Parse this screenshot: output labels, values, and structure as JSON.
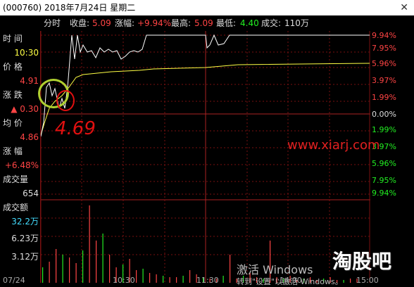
{
  "title_bar": {
    "text": "(000760) 2018年7月24日 星期二",
    "close_glyph": "✕"
  },
  "info": {
    "mode": "分时",
    "close_label": "收盘:",
    "close_value": "5.09",
    "change_label": "涨幅:",
    "change_value": "+9.94%",
    "high_label": "最高:",
    "high_value": "5.09",
    "low_label": "最低:",
    "low_value": "4.40",
    "volume_label": "成交:",
    "volume_value": "110万"
  },
  "side": {
    "time_label": "时  间",
    "time_value": "10:30",
    "price_label": "价  格",
    "price_value": "4.91",
    "change_label": "涨  跌",
    "change_value": "▲ 0.30",
    "avg_label": "均  价",
    "avg_value": "4.86",
    "pct_label": "涨  幅",
    "pct_value": "+6.48%",
    "vol_label": "成交量",
    "vol_value": "654",
    "amt_label": "成交额",
    "amt_value": "32.2万",
    "vol_axis_1": "6.23万",
    "vol_axis_2": "3.12万"
  },
  "pct_axis": [
    "9.94%",
    "7.95%",
    "5.96%",
    "3.97%",
    "1.99%",
    "0.00%",
    "1.99%",
    "3.97%",
    "5.96%",
    "7.95%",
    "9.94%"
  ],
  "time_axis": [
    "07/24",
    "10:30",
    "11:30",
    "14:00",
    "15:00"
  ],
  "watermark_site": "www.xiarj.com",
  "watermark_brand": "淘股吧",
  "windows_watermark": "激活 Windows",
  "windows_watermark_sub": "转到\"设置\"以激活 Windows。",
  "annotation_text": "4.69",
  "colors": {
    "up": "#ff4444",
    "down": "#22ee22",
    "avg": "#ffff44",
    "price": "#ffffff",
    "grid": "#7a1010"
  }
}
